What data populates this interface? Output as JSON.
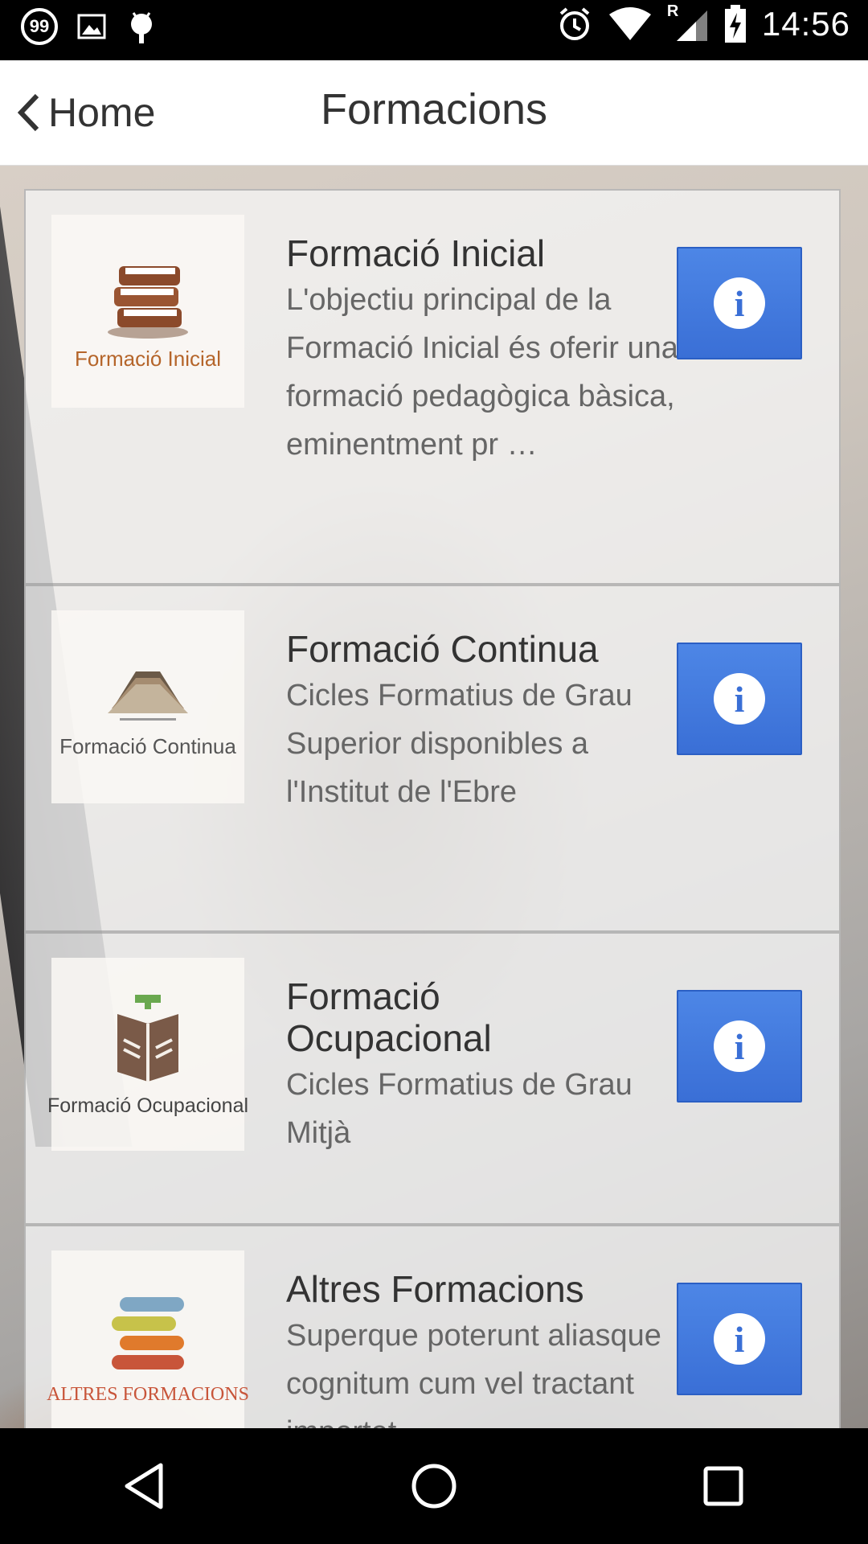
{
  "status_bar": {
    "notification_count": "99",
    "time": "14:56",
    "signal_roaming": "R",
    "icons": [
      "notification-count-icon",
      "image-icon",
      "android-icon",
      "alarm-icon",
      "wifi-icon",
      "cell-signal-icon",
      "battery-charging-icon"
    ]
  },
  "app_bar": {
    "back_label": "Home",
    "title": "Formacions"
  },
  "cards": [
    {
      "thumb_caption": "Formació Inicial",
      "title": "Formació Inicial",
      "description": "L'objectiu principal de la Formació Inicial és oferir una formació pedagògica bàsica, eminentment pr …",
      "icon": "books-stack-icon"
    },
    {
      "thumb_caption": "Formació Continua",
      "title": "Formació Continua",
      "description": "Cicles Formatius de Grau Superior disponibles a l'Institut de l'Ebre",
      "icon": "open-book-icon"
    },
    {
      "thumb_caption": "Formació Ocupacional",
      "title": "Formació Ocupacional",
      "description": "Cicles Formatius de Grau Mitjà",
      "icon": "book-hands-icon"
    },
    {
      "thumb_caption": "ALTRES FORMACIONS",
      "title": "Altres Formacions",
      "description": "Superque poterunt aliasque cognitum cum vel tractant impertet",
      "icon": "colored-books-icon"
    }
  ],
  "info_symbol": "i",
  "colors": {
    "info_button": "#3a6fd6",
    "thumb_text": "#6b4d3a"
  },
  "nav_bar": {
    "icons": [
      "back-triangle-icon",
      "home-circle-icon",
      "recents-square-icon"
    ]
  }
}
